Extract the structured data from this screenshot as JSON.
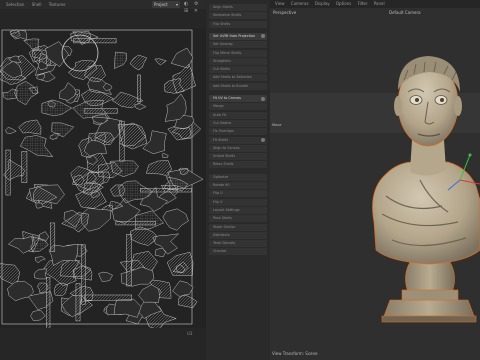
{
  "uv_editor": {
    "menu": [
      "Selection",
      "Shell",
      "Textures"
    ],
    "dropdown": "Project",
    "tool_icons": "◐ ⚙ ⊞ ✕",
    "footer": "U3"
  },
  "commands": [
    {
      "label": "Align Shells",
      "highlight": false,
      "icon": false
    },
    {
      "label": "Normalize Shells",
      "highlight": false,
      "icon": false
    },
    {
      "label": "Flip Shells",
      "highlight": false,
      "icon": false
    },
    {
      "label": "Set UVMI from Projection",
      "highlight": true,
      "icon": true
    },
    {
      "label": "Set Unwrap",
      "highlight": false,
      "icon": false
    },
    {
      "label": "Flip Mirror Shells",
      "highlight": false,
      "icon": false
    },
    {
      "label": "Straighten",
      "highlight": false,
      "icon": false
    },
    {
      "label": "Cut Shells",
      "highlight": false,
      "icon": false
    },
    {
      "label": "Add Shells to Selection",
      "highlight": false,
      "icon": false
    },
    {
      "label": "Add Shells to Bundle",
      "highlight": false,
      "icon": false
    },
    {
      "label": "Fit UV to Canvas",
      "highlight": true,
      "icon": true
    },
    {
      "label": "Merge",
      "highlight": false,
      "icon": false
    },
    {
      "label": "Auto Fit",
      "highlight": false,
      "icon": false
    },
    {
      "label": "Cut Seams",
      "highlight": false,
      "icon": false
    },
    {
      "label": "Fix Overlaps",
      "highlight": false,
      "icon": false
    },
    {
      "label": "Fit Shells",
      "highlight": false,
      "icon": true
    },
    {
      "label": "Align to Canvas",
      "highlight": false,
      "icon": false
    },
    {
      "label": "Unfold Shells",
      "highlight": false,
      "icon": false
    },
    {
      "label": "Relax Shells",
      "highlight": false,
      "icon": false
    },
    {
      "label": "Optimize",
      "highlight": false,
      "icon": false
    },
    {
      "label": "Rotate 90",
      "highlight": false,
      "icon": false
    },
    {
      "label": "Flip U",
      "highlight": false,
      "icon": false
    },
    {
      "label": "Flip V",
      "highlight": false,
      "icon": false
    },
    {
      "label": "Layout Settings",
      "highlight": false,
      "icon": false
    },
    {
      "label": "Pack Shells",
      "highlight": false,
      "icon": false
    },
    {
      "label": "Stack Similar",
      "highlight": false,
      "icon": false
    },
    {
      "label": "Distribute",
      "highlight": false,
      "icon": false
    },
    {
      "label": "Texel Density",
      "highlight": false,
      "icon": false
    },
    {
      "label": "Checker",
      "highlight": false,
      "icon": false
    }
  ],
  "viewport": {
    "menu": [
      "View",
      "Cameras",
      "Display",
      "Options",
      "Filter",
      "Panel"
    ],
    "view_name": "Perspective",
    "camera_label": "Default Camera",
    "side_label": "Move",
    "footer": "View Transform: Scene"
  },
  "colors": {
    "uv_line": "#d0d0d0",
    "highlight_button": "#3a3a3a",
    "bust_stone": "#b9ab92",
    "selection_outline": "#e06a1b"
  }
}
